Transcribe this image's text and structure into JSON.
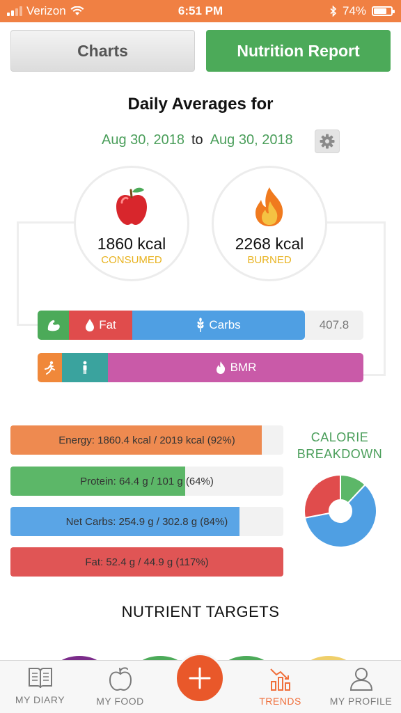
{
  "status_bar": {
    "carrier": "Verizon",
    "time": "6:51 PM",
    "battery": "74%",
    "battery_level": 0.74
  },
  "tabs": {
    "charts_label": "Charts",
    "report_label": "Nutrition Report",
    "active": "Nutrition Report"
  },
  "header": {
    "title": "Daily Averages for",
    "start_date": "Aug 30, 2018",
    "to_label": "to",
    "end_date": "Aug 30, 2018"
  },
  "summary": {
    "consumed_kcal": "1860 kcal",
    "consumed_label": "CONSUMED",
    "burned_kcal": "2268 kcal",
    "burned_label": "BURNED"
  },
  "macro_bar": {
    "fat_label": "Fat",
    "carbs_label": "Carbs",
    "remainder_value": "407.8"
  },
  "burn_bar": {
    "bmr_label": "BMR"
  },
  "targets": [
    {
      "label": "Energy: 1860.4 kcal / 2019 kcal (92%)",
      "progress": 0.92,
      "color": "#ee8a50"
    },
    {
      "label": "Protein: 64.4 g / 101 g (64%)",
      "progress": 0.64,
      "color": "#5cb768"
    },
    {
      "label": "Net Carbs: 254.9 g / 302.8 g (84%)",
      "progress": 0.84,
      "color": "#5aa5e6"
    },
    {
      "label": "Fat: 52.4 g / 44.9 g (117%)",
      "progress": 1.0,
      "color": "#e05555"
    }
  ],
  "calorie_breakdown": {
    "title_line1": "CALORIE",
    "title_line2": "BREAKDOWN",
    "slices": [
      {
        "name": "Protein",
        "fraction": 0.12,
        "color": "#5cb768"
      },
      {
        "name": "Carbs",
        "fraction": 0.6,
        "color": "#4f9fe3"
      },
      {
        "name": "Fat",
        "fraction": 0.28,
        "color": "#e04c4c"
      }
    ]
  },
  "section_title": "NUTRIENT TARGETS",
  "nav": {
    "diary": "MY DIARY",
    "food": "MY FOOD",
    "trends": "TRENDS",
    "profile": "MY PROFILE",
    "active": "TRENDS"
  },
  "colors": {
    "orange": "#f08043",
    "green": "#4caa59",
    "red": "#e04c4c",
    "blue": "#4f9fe3",
    "teal": "#3aa39e",
    "magenta": "#c95aa8",
    "gold": "#e8b320"
  }
}
